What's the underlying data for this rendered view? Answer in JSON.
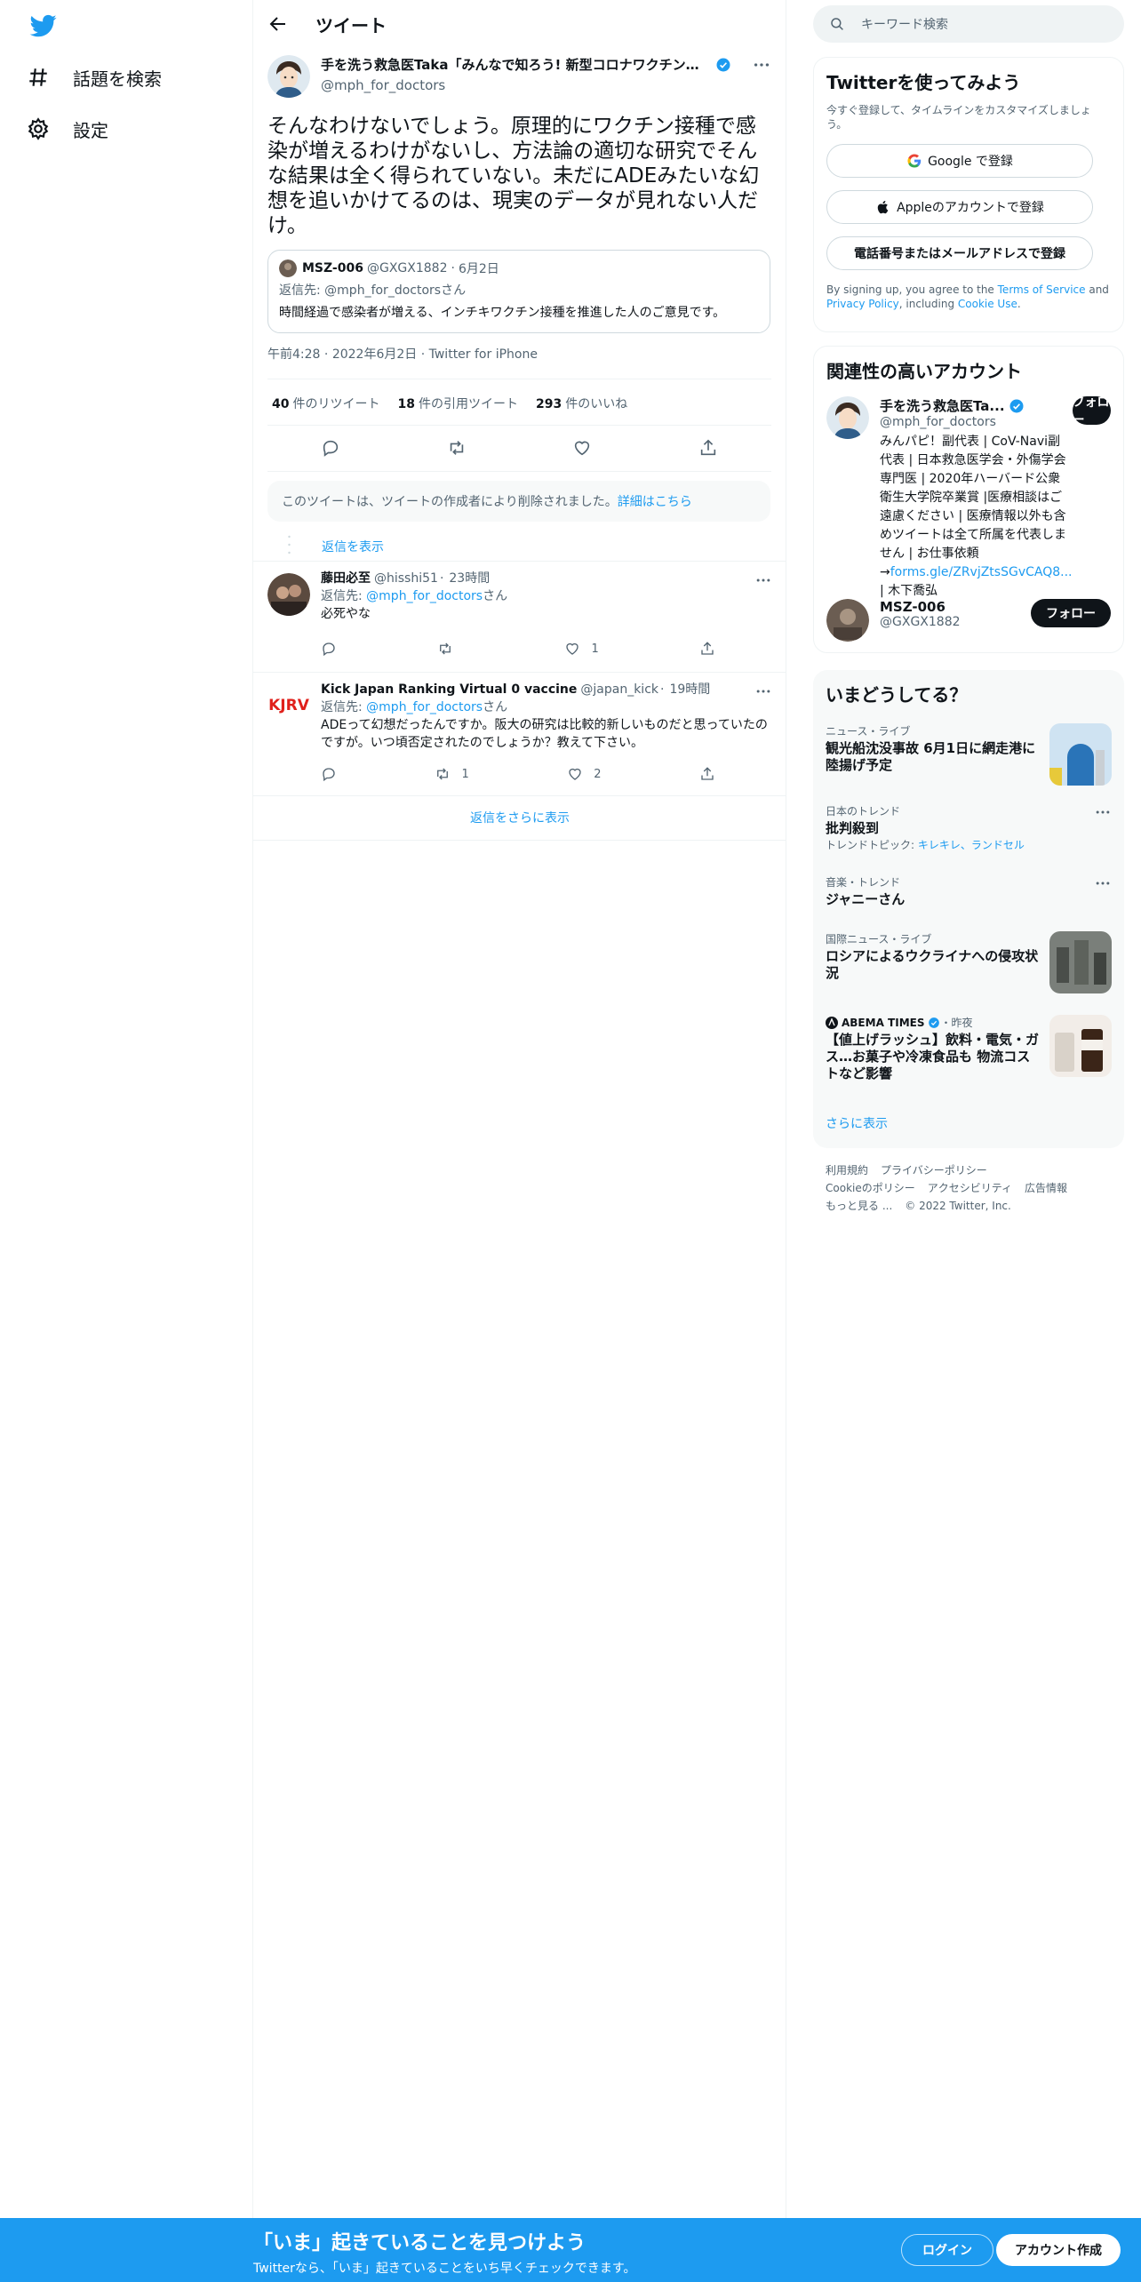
{
  "nav": {
    "explore_label": "話題を検索",
    "settings_label": "設定"
  },
  "header": {
    "title": "ツイート"
  },
  "tweet": {
    "author_name": "手を洗う救急医Taka「みんなで知ろう! 新型コロナワクチンとH...",
    "author_handle": "@mph_for_doctors",
    "text": "そんなわけないでしょう。原理的にワクチン接種で感染が増えるわけがないし、方法論の適切な研究でそんな結果は全く得られていない。未だにADEみたいな幻想を追いかけてるのは、現実のデータが見れない人だけ。",
    "quote": {
      "author_name": "MSZ-006",
      "author_handle": "@GXGX1882",
      "date": "6月2日",
      "reply_to": "返信先: @mph_for_doctorsさん",
      "text": "時間経過で感染者が増える、インチキワクチン接種を推進した人のご意見です。"
    },
    "time": "午前4:28",
    "date": "2022年6月2日",
    "client": "Twitter for iPhone",
    "retweets_count": "40",
    "retweets_label": "件のリツイート",
    "quotes_count": "18",
    "quotes_label": "件の引用ツイート",
    "likes_count": "293",
    "likes_label": "件のいいね"
  },
  "deleted_notice": {
    "text": "このツイートは、ツイートの作成者により削除されました。",
    "link": "詳細はこちら"
  },
  "show_replies": "返信を表示",
  "replies": [
    {
      "name": "藤田必至",
      "handle": "@hisshi51",
      "time": "23時間",
      "reply_prefix": "返信先: ",
      "reply_handle": "@mph_for_doctors",
      "reply_suffix": "さん",
      "text": "必死やな",
      "retweets": "",
      "likes": "1"
    },
    {
      "name": "Kick Japan Ranking Virtual 0 vaccine",
      "handle": "@japan_kick",
      "time": "19時間",
      "reply_prefix": "返信先: ",
      "reply_handle": "@mph_for_doctors",
      "reply_suffix": "さん",
      "text": "ADEって幻想だったんですか。阪大の研究は比較的新しいものだと思っていたのですが。いつ頃否定されたのでしょうか？教えて下さい。",
      "retweets": "1",
      "likes": "2",
      "avatar_text": "KJRV"
    }
  ],
  "more_replies": "返信をさらに表示",
  "search": {
    "placeholder": "キーワード検索"
  },
  "signup_panel": {
    "title": "Twitterを使ってみよう",
    "subtitle": "今すぐ登録して、タイムラインをカスタマイズしましょう。",
    "google": "Google で登録",
    "apple": "Appleのアカウントで登録",
    "phone": "電話番号またはメールアドレスで登録",
    "tos_prefix": "By signing up, you agree to the ",
    "tos_link": "Terms of Service",
    "tos_and": " and ",
    "privacy_link": "Privacy Policy",
    "tos_middle": ", including ",
    "cookie_link": "Cookie Use",
    "tos_end": "."
  },
  "relevant": {
    "title": "関連性の高いアカウント",
    "accounts": [
      {
        "name": "手を洗う救急医Ta...",
        "handle": "@mph_for_doctors",
        "follow": "フォロー",
        "bio": "みんパピ！副代表 | CoV-Navi副代表 | 日本救急医学会・外傷学会専門医 | 2020年ハーバード公衆衛生大学院卒業賞 |医療相談はご遠慮ください | 医療情報以外も含めツイートは全て所属を代表しません | お仕事依頼→",
        "bio_link": "forms.gle/ZRvjZtsSGvCAQ8...",
        "bio_end": " | 木下喬弘"
      },
      {
        "name": "MSZ-006",
        "handle": "@GXGX1882",
        "follow": "フォロー"
      }
    ]
  },
  "trends": {
    "title": "いまどうしてる？",
    "items": [
      {
        "category": "ニュース・ライブ",
        "title": "観光船沈没事故 6月1日に網走港に陸揚げ予定"
      },
      {
        "category": "日本のトレンド",
        "title": "批判殺到",
        "topics_label": "トレンドトピック: ",
        "topics": "キレキレ、ランドセル"
      },
      {
        "category": "音楽・トレンド",
        "title": "ジャニーさん"
      },
      {
        "category": "国際ニュース・ライブ",
        "title": "ロシアによるウクライナへの侵攻状況"
      },
      {
        "category": "ABEMA TIMES",
        "time": "・昨夜",
        "title": "【値上げラッシュ】飲料・電気・ガス…お菓子や冷凍食品も 物流コストなど影響"
      }
    ],
    "show_more": "さらに表示"
  },
  "footer": {
    "links": [
      "利用規約",
      "プライバシーポリシー",
      "Cookieのポリシー",
      "アクセシビリティ",
      "広告情報",
      "もっと見る ..."
    ],
    "copyright": "© 2022 Twitter, Inc."
  },
  "banner": {
    "title": "「いま」起きていることを見つけよう",
    "subtitle": "Twitterなら、「いま」起きていることをいち早くチェックできます。",
    "login": "ログイン",
    "signup": "アカウント作成"
  },
  "colors": {
    "accent": "#1d9bf0",
    "text": "#0f1419",
    "muted": "#536471"
  }
}
